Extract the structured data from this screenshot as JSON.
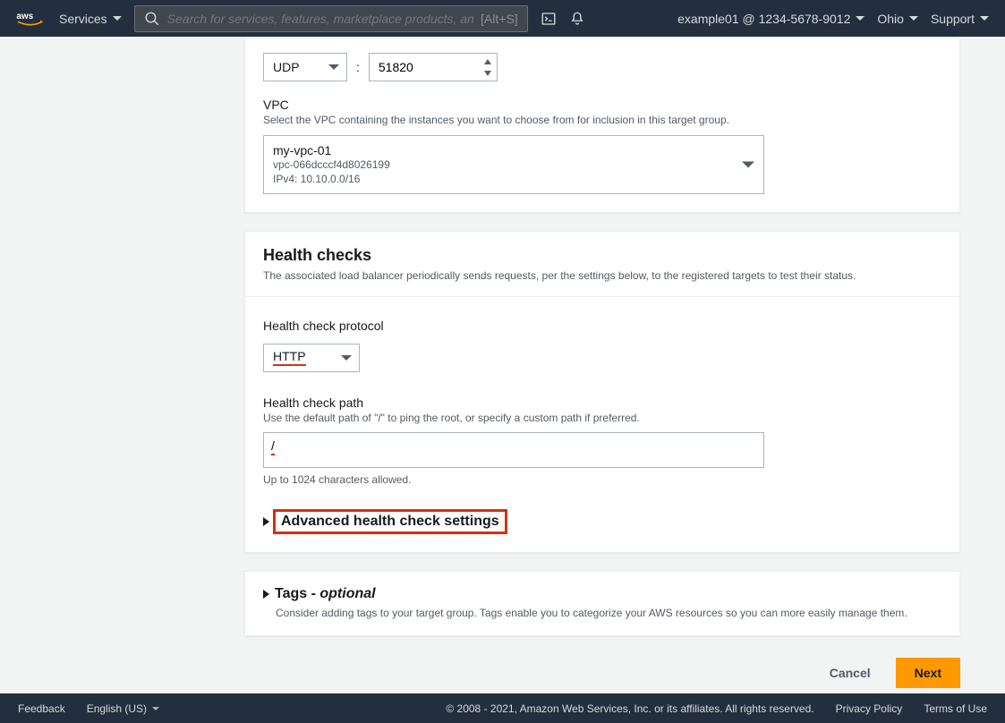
{
  "nav": {
    "services": "Services",
    "search_placeholder": "Search for services, features, marketplace products, and",
    "search_hint": "[Alt+S]",
    "account": "example01 @ 1234-5678-9012",
    "region": "Ohio",
    "support": "Support"
  },
  "protocol": {
    "value": "UDP",
    "port": "51820"
  },
  "vpc": {
    "label": "VPC",
    "help": "Select the VPC containing the instances you want to choose from for inclusion in this target group.",
    "name": "my-vpc-01",
    "id": "vpc-066dcccf4d8026199",
    "cidr": "IPv4: 10.10.0.0/16"
  },
  "health": {
    "title": "Health checks",
    "subtitle": "The associated load balancer periodically sends requests, per the settings below, to the registered targets to test their status.",
    "protocol_label": "Health check protocol",
    "protocol_value": "HTTP",
    "path_label": "Health check path",
    "path_help": "Use the default path of \"/\" to ping the root, or specify a custom path if preferred.",
    "path_value": "/",
    "path_note": "Up to 1024 characters allowed.",
    "advanced": "Advanced health check settings"
  },
  "tags": {
    "title_prefix": "Tags - ",
    "title_optional": "optional",
    "help": "Consider adding tags to your target group. Tags enable you to categorize your AWS resources so you can more easily manage them."
  },
  "actions": {
    "cancel": "Cancel",
    "next": "Next"
  },
  "footer": {
    "feedback": "Feedback",
    "language": "English (US)",
    "copyright": "© 2008 - 2021, Amazon Web Services, Inc. or its affiliates. All rights reserved.",
    "privacy": "Privacy Policy",
    "terms": "Terms of Use"
  }
}
